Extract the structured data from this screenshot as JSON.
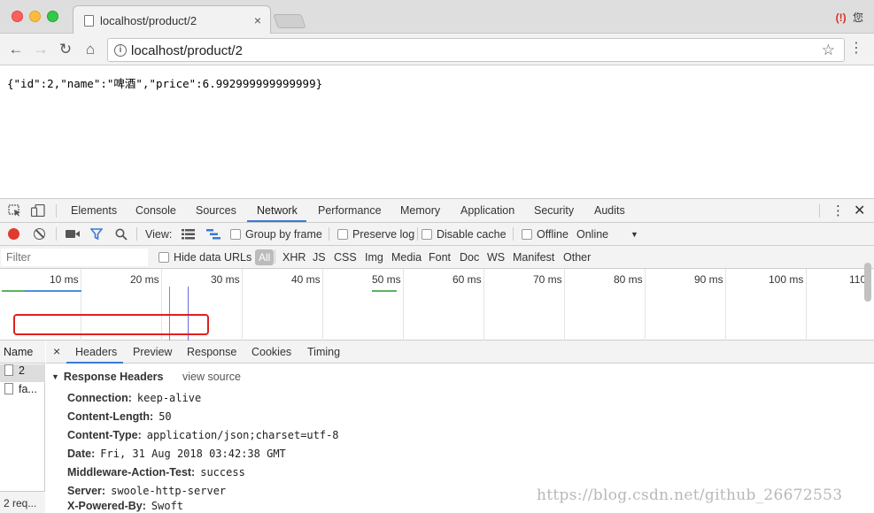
{
  "browser": {
    "tab_title": "localhost/product/2",
    "tab_close": "×",
    "ext_icon": "(!)",
    "ext_label": "您",
    "url": "localhost/product/2",
    "info_icon": "i"
  },
  "page": {
    "json_text": "{\"id\":2,\"name\":\"啤酒\",\"price\":6.992999999999999}"
  },
  "devtools": {
    "tabs": [
      "Elements",
      "Console",
      "Sources",
      "Network",
      "Performance",
      "Memory",
      "Application",
      "Security",
      "Audits"
    ],
    "active_tab": "Network",
    "toolbar": {
      "view_label": "View:",
      "group_by_frame": "Group by frame",
      "preserve_log": "Preserve log",
      "disable_cache": "Disable cache",
      "offline": "Offline",
      "throttle": "Online"
    },
    "filter": {
      "placeholder": "Filter",
      "hide_data_urls": "Hide data URLs",
      "types": [
        "All",
        "XHR",
        "JS",
        "CSS",
        "Img",
        "Media",
        "Font",
        "Doc",
        "WS",
        "Manifest",
        "Other"
      ]
    },
    "timeline_labels": [
      "10 ms",
      "20 ms",
      "30 ms",
      "40 ms",
      "50 ms",
      "60 ms",
      "70 ms",
      "80 ms",
      "90 ms",
      "100 ms",
      "110"
    ],
    "requests": {
      "header": "Name",
      "items": [
        "2",
        "fa..."
      ],
      "footer": "2 req..."
    },
    "detail": {
      "close": "×",
      "tabs": [
        "Headers",
        "Preview",
        "Response",
        "Cookies",
        "Timing"
      ],
      "active_tab": "Headers",
      "section_title": "Response Headers",
      "view_source": "view source",
      "headers": [
        {
          "name": "Connection:",
          "value": "keep-alive"
        },
        {
          "name": "Content-Length:",
          "value": "50"
        },
        {
          "name": "Content-Type:",
          "value": "application/json;charset=utf-8"
        },
        {
          "name": "Date:",
          "value": "Fri, 31 Aug 2018 03:42:38 GMT"
        },
        {
          "name": "Middleware-Action-Test:",
          "value": "success"
        },
        {
          "name": "Server:",
          "value": "swoole-http-server"
        },
        {
          "name": "X-Powered-By:",
          "value": "Swoft"
        }
      ]
    }
  },
  "watermark": "https://blog.csdn.net/github_26672553",
  "colors": {
    "highlight": "#e0201d",
    "accent": "#3879d9",
    "record": "#e03a2f"
  }
}
